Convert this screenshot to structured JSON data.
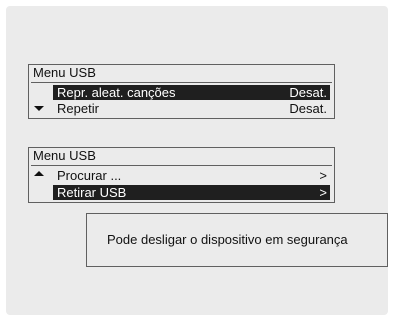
{
  "menu1": {
    "title": "Menu USB",
    "items": [
      {
        "label": "Repr. aleat. canções",
        "value": "Desat.",
        "selected": true
      },
      {
        "label": "Repetir",
        "value": "Desat.",
        "selected": false
      }
    ]
  },
  "menu2": {
    "title": "Menu USB",
    "items": [
      {
        "label": "Procurar ...",
        "value": ">",
        "selected": false
      },
      {
        "label": "Retirar USB",
        "value": ">",
        "selected": true
      }
    ]
  },
  "message": {
    "text": "Pode desligar o dispositivo em segurança"
  },
  "icons": {
    "scroll_down": "arrow-down-icon",
    "scroll_up": "arrow-up-icon"
  }
}
